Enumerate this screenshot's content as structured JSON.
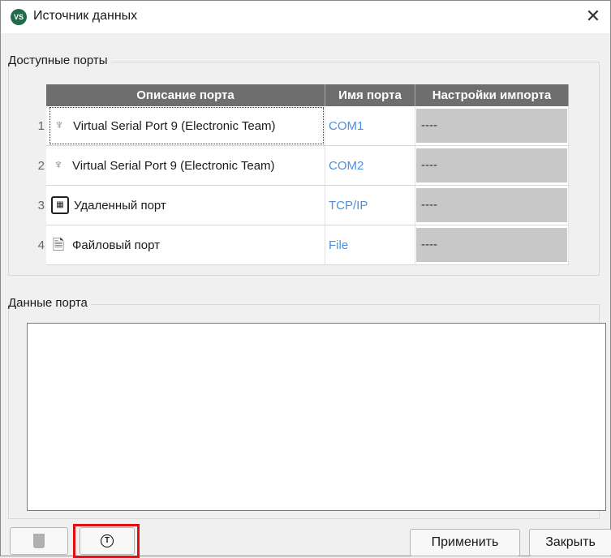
{
  "window": {
    "title": "Источник данных",
    "app_icon_text": "VS",
    "close_glyph": "✕"
  },
  "ports_group": {
    "label": "Доступные порты",
    "columns": [
      "Описание порта",
      "Имя порта",
      "Настройки импорта"
    ],
    "rows": [
      {
        "num": "1",
        "icon": "serial-port-icon",
        "description": "Virtual Serial Port 9 (Electronic Team)",
        "port": "COM1",
        "settings": "----"
      },
      {
        "num": "2",
        "icon": "serial-port-icon",
        "description": "Virtual Serial Port 9 (Electronic Team)",
        "port": "COM2",
        "settings": "----"
      },
      {
        "num": "3",
        "icon": "network-port-icon",
        "description": "Удаленный порт",
        "port": "TCP/IP",
        "settings": "----"
      },
      {
        "num": "4",
        "icon": "file-port-icon",
        "description": "Файловый порт",
        "port": "File",
        "settings": "----"
      }
    ]
  },
  "data_group": {
    "label": "Данные порта",
    "content": ""
  },
  "buttons": {
    "apply": "Применить",
    "close": "Закрыть",
    "t_glyph": "T"
  },
  "colors": {
    "header_bg": "#6e6e6e",
    "port_link": "#4a90e2",
    "highlight": "#e01010"
  }
}
